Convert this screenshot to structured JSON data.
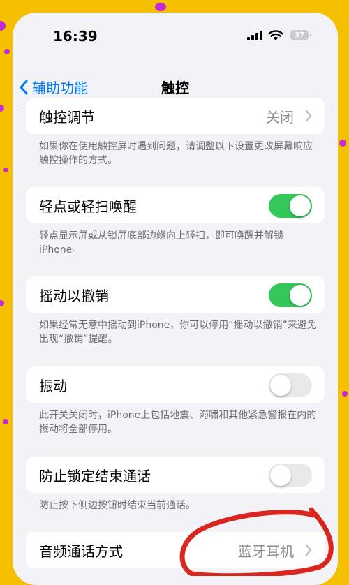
{
  "status_bar": {
    "time": "16:39",
    "battery": "37",
    "signal_icon": "cellular-signal-icon",
    "wifi_icon": "wifi-icon"
  },
  "nav": {
    "back_label": "辅助功能",
    "title": "触控"
  },
  "settings": [
    {
      "label": "触控调节",
      "value": "关闭",
      "type": "link",
      "note": "如果你在使用触控屏时遇到问题，请调整以下设置更改屏幕响应触控操作的方式。"
    },
    {
      "label": "轻点或轻扫唤醒",
      "type": "toggle",
      "on": true,
      "note": "轻点显示屏或从锁屏底部边缘向上轻扫，即可唤醒并解锁iPhone。"
    },
    {
      "label": "摇动以撤销",
      "type": "toggle",
      "on": true,
      "note": "如果经常无意中摇动到iPhone，你可以停用“摇动以撤销”来避免出现“撤销”提醒。"
    },
    {
      "label": "振动",
      "type": "toggle",
      "on": false,
      "note": "此开关关闭时，iPhone上包括地震、海啸和其他紧急警报在内的振动将全部停用。"
    },
    {
      "label": "防止锁定结束通话",
      "type": "toggle",
      "on": false,
      "note": "防止按下侧边按钮时结束当前通话。"
    },
    {
      "label": "音频通话方式",
      "value": "蓝牙耳机",
      "type": "link"
    }
  ],
  "colors": {
    "accent": "#007aff",
    "toggle_on": "#34c759",
    "toggle_off": "#e9e9ea",
    "background": "#f2f2f7",
    "annotation": "#d9271f"
  }
}
